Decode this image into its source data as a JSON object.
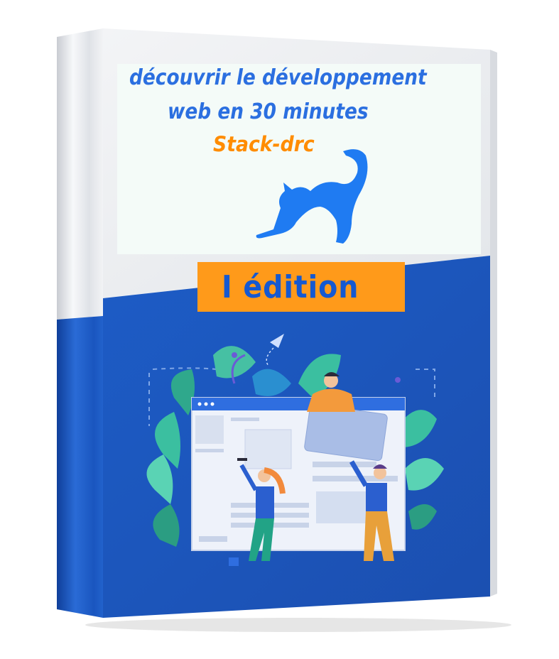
{
  "cover": {
    "title_line1": "découvrir le développement",
    "title_line2": "web en 30 minutes",
    "brand": "Stack-drc",
    "edition": "I édition"
  },
  "colors": {
    "title_blue": "#2b6fe0",
    "brand_orange": "#ff8c00",
    "edition_bg": "#ff9a1a",
    "edition_text": "#1559d1",
    "cover_blue": "#1a5bc4",
    "cat_blue": "#1f7bf2"
  },
  "icons": [
    "cat-icon",
    "paper-plane-icon",
    "browser-window-illustration",
    "leaves-illustration"
  ]
}
